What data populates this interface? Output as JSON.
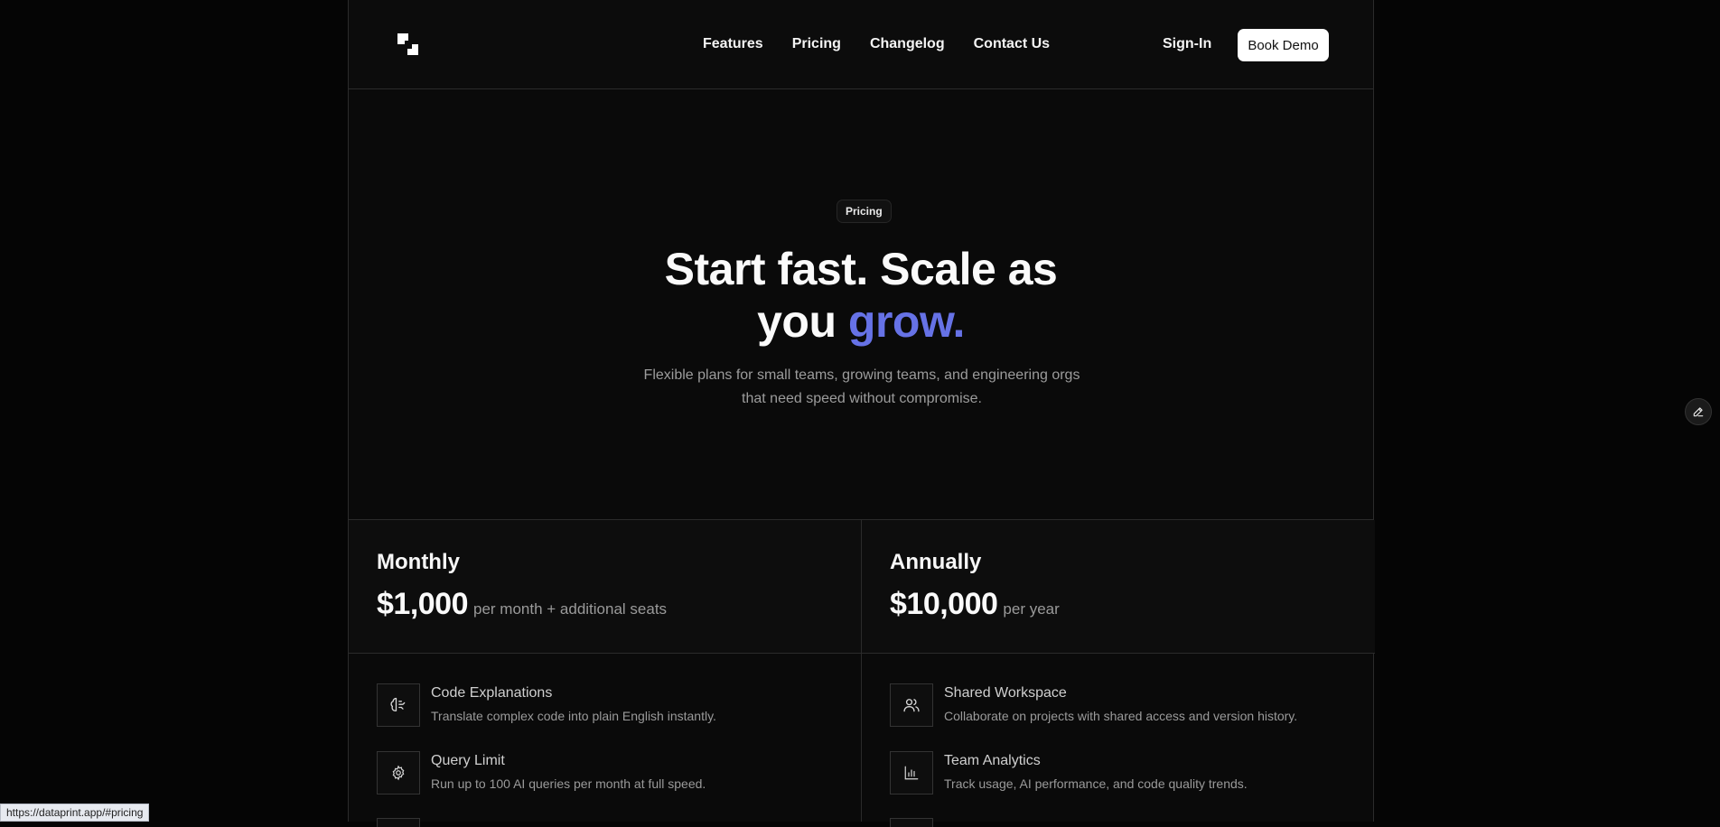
{
  "nav": {
    "links": [
      "Features",
      "Pricing",
      "Changelog",
      "Contact Us"
    ],
    "signin_label": "Sign-In",
    "book_demo_label": "Book Demo"
  },
  "hero": {
    "pill": "Pricing",
    "headline_line1": "Start fast. Scale as",
    "headline_line2_prefix": "you ",
    "headline_accent": "grow.",
    "subtitle": "Flexible plans for small teams, growing teams, and engineering orgs that need speed without compromise."
  },
  "plans": [
    {
      "name": "Monthly",
      "price": "$1,000",
      "note": "per month + additional seats",
      "features": [
        {
          "icon": "brain-icon",
          "title": "Code Explanations",
          "desc": "Translate complex code into plain English instantly."
        },
        {
          "icon": "gear-icon",
          "title": "Query Limit",
          "desc": "Run up to 100 AI queries per month at full speed."
        }
      ]
    },
    {
      "name": "Annually",
      "price": "$10,000",
      "note": "per year",
      "features": [
        {
          "icon": "users-icon",
          "title": "Shared Workspace",
          "desc": "Collaborate on projects with shared access and version history."
        },
        {
          "icon": "bar-chart-icon",
          "title": "Team Analytics",
          "desc": "Track usage, AI performance, and code quality trends."
        }
      ]
    }
  ],
  "status_bar": {
    "url": "https://dataprint.app/#pricing"
  },
  "colors": {
    "accent": "#6672e6",
    "background": "#0a0a0a",
    "border": "#2b2b2b"
  }
}
